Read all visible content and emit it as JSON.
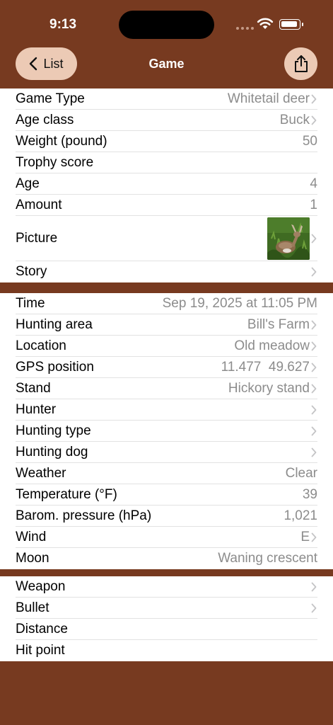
{
  "status_bar": {
    "time": "9:13"
  },
  "nav": {
    "back_label": "List",
    "title": "Game"
  },
  "section1": [
    {
      "label": "Game Type",
      "value": "Whitetail deer",
      "chevron": true
    },
    {
      "label": "Age class",
      "value": "Buck",
      "chevron": true
    },
    {
      "label": "Weight (pound)",
      "value": "50",
      "chevron": false
    },
    {
      "label": "Trophy score",
      "value": "",
      "chevron": false
    },
    {
      "label": "Age",
      "value": "4",
      "chevron": false
    },
    {
      "label": "Amount",
      "value": "1",
      "chevron": false
    },
    {
      "label": "Picture",
      "value": "",
      "chevron": true,
      "image": "deer-photo"
    },
    {
      "label": "Story",
      "value": "",
      "chevron": true
    }
  ],
  "section2": [
    {
      "label": "Time",
      "value": "Sep 19, 2025 at 11:05 PM",
      "chevron": false
    },
    {
      "label": "Hunting area",
      "value": "Bill's Farm",
      "chevron": true
    },
    {
      "label": "Location",
      "value": "Old meadow",
      "chevron": true
    },
    {
      "label": "GPS position",
      "value": "11.477  49.627",
      "chevron": true
    },
    {
      "label": "Stand",
      "value": "Hickory stand",
      "chevron": true
    },
    {
      "label": "Hunter",
      "value": "",
      "chevron": true
    },
    {
      "label": "Hunting type",
      "value": "",
      "chevron": true
    },
    {
      "label": "Hunting dog",
      "value": "",
      "chevron": true
    },
    {
      "label": "Weather",
      "value": "Clear",
      "chevron": false
    },
    {
      "label": "Temperature (°F)",
      "value": "39",
      "chevron": false
    },
    {
      "label": "Barom. pressure (hPa)",
      "value": "1,021",
      "chevron": false
    },
    {
      "label": "Wind",
      "value": "E",
      "chevron": true
    },
    {
      "label": "Moon",
      "value": "Waning crescent",
      "chevron": false
    }
  ],
  "section3": [
    {
      "label": "Weapon",
      "value": "",
      "chevron": true
    },
    {
      "label": "Bullet",
      "value": "",
      "chevron": true
    },
    {
      "label": "Distance",
      "value": "",
      "chevron": false
    },
    {
      "label": "Hit point",
      "value": "",
      "chevron": false
    }
  ],
  "colors": {
    "background": "#773a20",
    "button": "#eccab5",
    "secondary_text": "#8c8c8c"
  }
}
